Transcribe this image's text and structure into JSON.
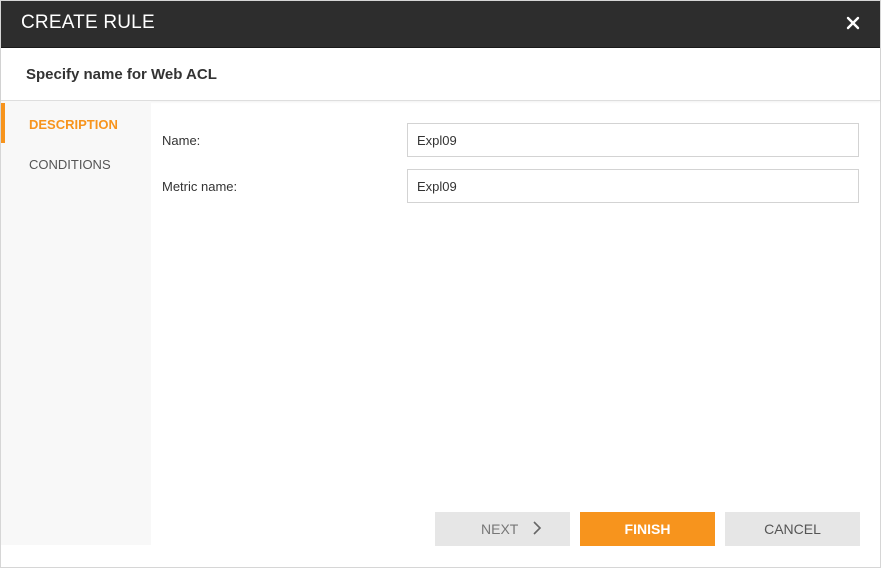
{
  "dialog": {
    "title": "CREATE RULE",
    "close_icon": "close-icon",
    "subtitle": "Specify name for Web ACL"
  },
  "sidebar": {
    "items": [
      {
        "label": "DESCRIPTION",
        "active": true
      },
      {
        "label": "CONDITIONS",
        "active": false
      }
    ]
  },
  "form": {
    "name_label": "Name:",
    "name_value": "Expl09",
    "metric_label": "Metric name:",
    "metric_value": "Expl09"
  },
  "buttons": {
    "next_label": "NEXT",
    "next_icon": "chevron-right-icon",
    "finish_label": "FINISH",
    "cancel_label": "CANCEL"
  },
  "colors": {
    "accent": "#f7941d",
    "titlebar": "#2d2d2d",
    "sidebar_bg": "#f8f8f8",
    "button_gray": "#e6e6e6"
  }
}
